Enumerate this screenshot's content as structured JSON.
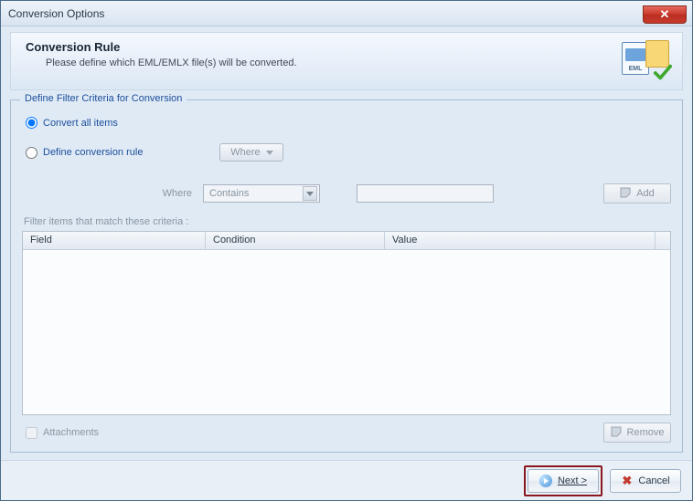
{
  "window": {
    "title": "Conversion Options"
  },
  "header": {
    "title": "Conversion Rule",
    "subtitle": "Please define which EML/EMLX file(s) will be converted."
  },
  "fieldset": {
    "legend": "Define Filter Criteria for Conversion",
    "radio_all": "Convert all items",
    "radio_rule": "Define conversion rule",
    "where_pill": "Where",
    "where_label": "Where",
    "condition_value": "Contains",
    "add_label": "Add",
    "hint": "Filter items that match these criteria :",
    "columns": {
      "field": "Field",
      "condition": "Condition",
      "value": "Value"
    },
    "attachments_label": "Attachments",
    "remove_label": "Remove"
  },
  "footer": {
    "next": "Next >",
    "cancel": "Cancel"
  }
}
